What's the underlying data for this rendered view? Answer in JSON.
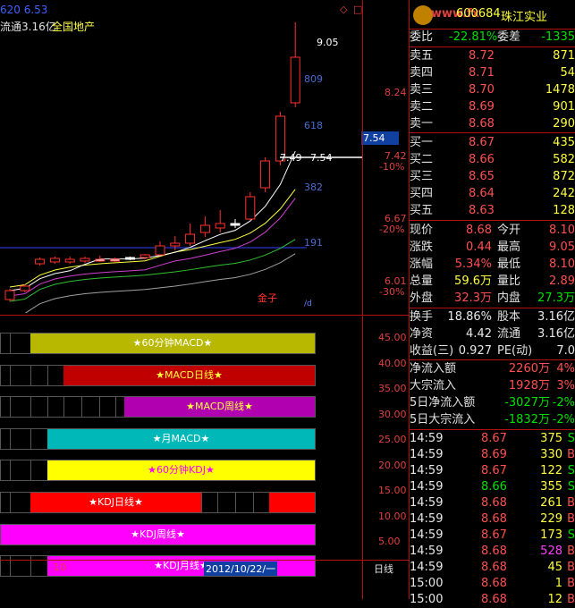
{
  "header": {
    "code_fragment": "620 6.53",
    "float_cap": "流通3.16亿",
    "sector": "全国地产",
    "stock_code": "600684",
    "stock_name": "珠江实业",
    "logo_text": "www.fx"
  },
  "chart": {
    "price_labels": [
      "8.24",
      "7.42",
      "-10%",
      "6.67",
      "-20%",
      "6.01",
      "-30%"
    ],
    "current_price_box": "7.54",
    "ma_labels": [
      "9.05",
      "809",
      "618",
      "7.49",
      "7.54",
      "382",
      "191"
    ],
    "gold_label": "金子",
    "small_mark": "/d",
    "candles": [
      {
        "o": 5.95,
        "c": 6.05,
        "h": 6.07,
        "l": 5.93
      },
      {
        "o": 6.05,
        "c": 6.1,
        "h": 6.12,
        "l": 6.03
      },
      {
        "o": 6.35,
        "c": 6.4,
        "h": 6.42,
        "l": 6.33
      },
      {
        "o": 6.37,
        "c": 6.41,
        "h": 6.43,
        "l": 6.35
      },
      {
        "o": 6.37,
        "c": 6.4,
        "h": 6.43,
        "l": 6.35
      },
      {
        "o": 6.38,
        "c": 6.41,
        "h": 6.43,
        "l": 6.36
      },
      {
        "o": 6.39,
        "c": 6.4,
        "h": 6.44,
        "l": 6.37
      },
      {
        "o": 6.38,
        "c": 6.4,
        "h": 6.42,
        "l": 6.37
      },
      {
        "o": 6.42,
        "c": 6.41,
        "h": 6.43,
        "l": 6.39
      },
      {
        "o": 6.42,
        "c": 6.45,
        "h": 6.46,
        "l": 6.4
      },
      {
        "o": 6.45,
        "c": 6.55,
        "h": 6.6,
        "l": 6.44
      },
      {
        "o": 6.55,
        "c": 6.58,
        "h": 6.66,
        "l": 6.5
      },
      {
        "o": 6.58,
        "c": 6.68,
        "h": 6.8,
        "l": 6.55
      },
      {
        "o": 6.7,
        "c": 6.78,
        "h": 6.88,
        "l": 6.65
      },
      {
        "o": 6.75,
        "c": 6.8,
        "h": 6.95,
        "l": 6.7
      },
      {
        "o": 6.8,
        "c": 6.78,
        "h": 6.85,
        "l": 6.75
      },
      {
        "o": 6.85,
        "c": 7.1,
        "h": 7.15,
        "l": 6.83
      },
      {
        "o": 7.2,
        "c": 7.5,
        "h": 7.54,
        "l": 7.15
      },
      {
        "o": 7.5,
        "c": 8.0,
        "h": 8.05,
        "l": 7.45
      },
      {
        "o": 8.15,
        "c": 8.66,
        "h": 9.05,
        "l": 8.1
      }
    ]
  },
  "indicators": {
    "axis": [
      "45.00",
      "40.00",
      "35.00",
      "30.00",
      "25.00",
      "20.00",
      "15.00",
      "10.00",
      "5.00"
    ],
    "bars": [
      {
        "label": "★60分钟MACD★",
        "label_color": "#ffffff",
        "fill": "#b8b800",
        "start": 33,
        "cells": [
          10,
          33
        ]
      },
      {
        "label": "★MACD日线★",
        "label_color": "#ffff40",
        "fill": "#c00000",
        "start": 70,
        "cells": [
          10,
          33,
          52,
          70
        ]
      },
      {
        "label": "★MACD周线★",
        "label_color": "#ffff40",
        "fill": "#b000b0",
        "start": 138,
        "cells": [
          10,
          33,
          52,
          70,
          90,
          110,
          128,
          138
        ]
      },
      {
        "label": "★月MACD★",
        "label_color": "#ffffff",
        "fill": "#00b8b8",
        "start": 52,
        "cells": [
          10,
          33,
          52
        ]
      },
      {
        "label": "★60分钟KDJ★",
        "label_color": "#ff00ff",
        "fill": "#ffff00",
        "start": 52,
        "cells": [
          10,
          33,
          52
        ]
      },
      {
        "label": "★KDJ日线★",
        "label_color": "#ffffff",
        "fill": "#ff0000",
        "start": 33,
        "cells": [
          10,
          33,
          224,
          242,
          262,
          282,
          300
        ]
      },
      {
        "label": "★KDJ周线★",
        "label_color": "#ffffff",
        "fill": "#ff00ff",
        "start": 0,
        "cells": []
      },
      {
        "label": "★KDJ月线★",
        "label_color": "#ffffff",
        "fill": "#ff00ff",
        "start": 52,
        "cells": [
          10,
          33,
          52
        ]
      }
    ]
  },
  "bottom": {
    "x_tick": "10",
    "date": "2012/10/22/一",
    "period": "日线"
  },
  "quote": {
    "weibi_label": "委比",
    "weibi": "-22.81%",
    "weicha_label": "委差",
    "weicha": "-1335",
    "asks": [
      {
        "label": "卖五",
        "price": "8.72",
        "vol": "871"
      },
      {
        "label": "卖四",
        "price": "8.71",
        "vol": "54"
      },
      {
        "label": "卖三",
        "price": "8.70",
        "vol": "1478"
      },
      {
        "label": "卖二",
        "price": "8.69",
        "vol": "901"
      },
      {
        "label": "卖一",
        "price": "8.68",
        "vol": "290"
      }
    ],
    "bids": [
      {
        "label": "买一",
        "price": "8.67",
        "vol": "435"
      },
      {
        "label": "买二",
        "price": "8.66",
        "vol": "582"
      },
      {
        "label": "买三",
        "price": "8.65",
        "vol": "872"
      },
      {
        "label": "买四",
        "price": "8.64",
        "vol": "242"
      },
      {
        "label": "买五",
        "price": "8.63",
        "vol": "128"
      }
    ],
    "stats": [
      {
        "l1": "现价",
        "v1": "8.68",
        "c1": "red",
        "l2": "今开",
        "v2": "8.10",
        "c2": "red"
      },
      {
        "l1": "涨跌",
        "v1": "0.44",
        "c1": "red",
        "l2": "最高",
        "v2": "9.05",
        "c2": "red"
      },
      {
        "l1": "涨幅",
        "v1": "5.34%",
        "c1": "red",
        "l2": "最低",
        "v2": "8.10",
        "c2": "red"
      },
      {
        "l1": "总量",
        "v1": "59.6万",
        "c1": "yel",
        "l2": "量比",
        "v2": "2.89",
        "c2": "red"
      },
      {
        "l1": "外盘",
        "v1": "32.3万",
        "c1": "red",
        "l2": "内盘",
        "v2": "27.3万",
        "c2": "grn"
      }
    ],
    "stats2": [
      {
        "l1": "换手",
        "v1": "18.86%",
        "l2": "股本",
        "v2": "3.16亿"
      },
      {
        "l1": "净资",
        "v1": "4.42",
        "l2": "流通",
        "v2": "3.16亿"
      },
      {
        "l1": "收益(三)",
        "v1": "0.927",
        "l2": "PE(动)",
        "v2": "7.0"
      }
    ],
    "flows": [
      {
        "label": "净流入额",
        "value": "2260万",
        "pct": "4%",
        "vc": "red"
      },
      {
        "label": "大宗流入",
        "value": "1928万",
        "pct": "3%",
        "vc": "red"
      },
      {
        "label": "5日净流入额",
        "value": "-3027万",
        "pct": "-2%",
        "vc": "grn"
      },
      {
        "label": "5日大宗流入",
        "value": "-1832万",
        "pct": "-2%",
        "vc": "grn"
      }
    ],
    "ticks": [
      {
        "time": "14:59",
        "price": "8.67",
        "vol": "375",
        "side": "S"
      },
      {
        "time": "14:59",
        "price": "8.69",
        "vol": "330",
        "side": "B"
      },
      {
        "time": "14:59",
        "price": "8.67",
        "vol": "122",
        "side": "S"
      },
      {
        "time": "14:59",
        "price": "8.66",
        "vol": "355",
        "side": "S"
      },
      {
        "time": "14:59",
        "price": "8.68",
        "vol": "261",
        "side": "B"
      },
      {
        "time": "14:59",
        "price": "8.68",
        "vol": "229",
        "side": "B"
      },
      {
        "time": "14:59",
        "price": "8.67",
        "vol": "173",
        "side": "S"
      },
      {
        "time": "14:59",
        "price": "8.68",
        "vol": "528",
        "side": "B"
      },
      {
        "time": "14:59",
        "price": "8.68",
        "vol": "45",
        "side": "B"
      },
      {
        "time": "15:00",
        "price": "8.68",
        "vol": "1",
        "side": "B"
      },
      {
        "time": "15:00",
        "price": "8.68",
        "vol": "12",
        "side": "B"
      }
    ]
  }
}
